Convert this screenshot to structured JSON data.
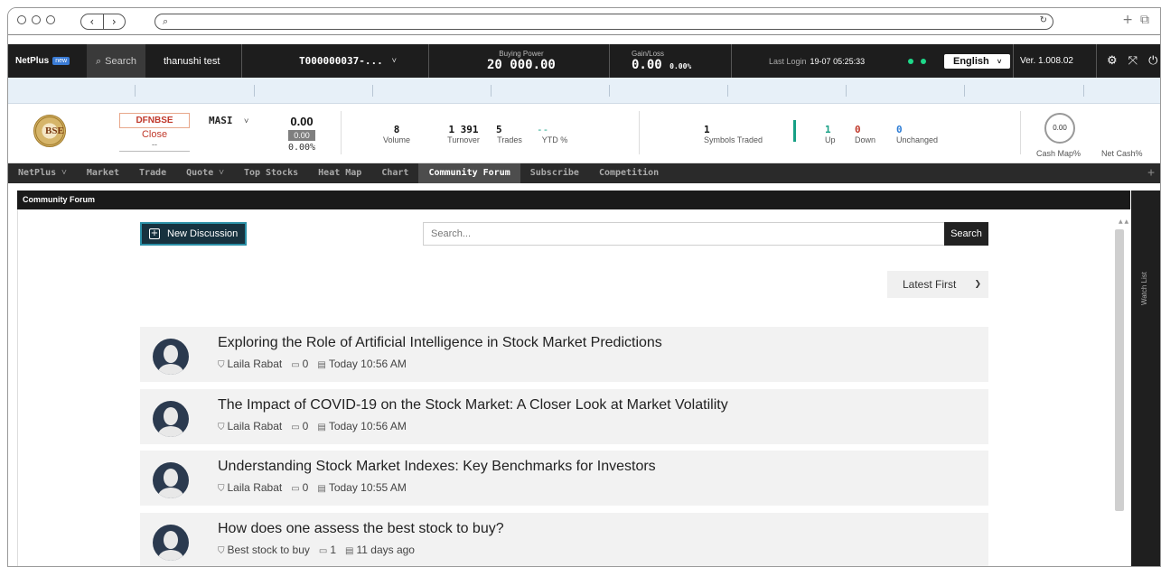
{
  "topbar": {
    "brand": "NetPlus",
    "brand_badge": "new",
    "search_label": "Search",
    "user_name": "thanushi test",
    "account_id": "T000000037-...",
    "buying_power_label": "Buying Power",
    "buying_power_value": "20 000.00",
    "gain_loss_label": "Gain/Loss",
    "gain_loss_value": "0.00",
    "gain_loss_pct": "0.00%",
    "last_login_label": "Last Login",
    "last_login_value": "19-07 05:25:33",
    "language": "English",
    "version": "Ver. 1.008.02"
  },
  "market": {
    "exchange_label": "DFNBSE",
    "status": "Close",
    "status_sub": "--",
    "index_name": "MASI",
    "index_value": "0.00",
    "index_change": "0.00",
    "index_change_pct": "0.00%",
    "stats": [
      {
        "value": "8",
        "label": "Volume"
      },
      {
        "value": "1 391",
        "label": "Turnover"
      },
      {
        "value": "5",
        "label": "Trades"
      },
      {
        "value": "--",
        "label": "YTD %"
      }
    ],
    "symbols_traded_value": "1",
    "symbols_traded_label": "Symbols Traded",
    "up_value": "1",
    "up_label": "Up",
    "down_value": "0",
    "down_label": "Down",
    "unchanged_value": "0",
    "unchanged_label": "Unchanged",
    "cash_map_value": "0.00",
    "cash_map_label": "Cash Map%",
    "net_cash_label": "Net Cash%"
  },
  "nav": {
    "tabs": [
      "NetPlus ˅",
      "Market",
      "Trade",
      "Quote ˅",
      "Top Stocks",
      "Heat Map",
      "Chart",
      "Community Forum",
      "Subscribe",
      "Competition"
    ],
    "active": "Community Forum"
  },
  "forum": {
    "panel_title": "Community Forum",
    "new_button": "New Discussion",
    "search_placeholder": "Search...",
    "search_button": "Search",
    "sort_value": "Latest First",
    "posts": [
      {
        "title": "Exploring the Role of Artificial Intelligence in Stock Market Predictions",
        "author": "Laila Rabat",
        "comments": "0",
        "time": "Today 10:56 AM"
      },
      {
        "title": "The Impact of COVID-19 on the Stock Market: A Closer Look at Market Volatility",
        "author": "Laila Rabat",
        "comments": "0",
        "time": "Today 10:56 AM"
      },
      {
        "title": "Understanding Stock Market Indexes: Key Benchmarks for Investors",
        "author": "Laila Rabat",
        "comments": "0",
        "time": "Today 10:55 AM"
      },
      {
        "title": "How does one assess the best stock to buy?",
        "author": "Best stock to buy",
        "comments": "1",
        "time": "11 days ago"
      }
    ]
  },
  "watchlist": {
    "label": "Watch List"
  },
  "colors": {
    "accent": "#2a8fa6",
    "up": "#16a085",
    "down": "#c0392b",
    "unchanged": "#2a7bd5",
    "dot": "#1ed98a"
  },
  "icons": [
    "search-icon",
    "chevron-down-icon",
    "gear-icon",
    "expand-icon",
    "power-icon",
    "plus-icon",
    "tag-icon",
    "comment-icon",
    "calendar-icon"
  ]
}
